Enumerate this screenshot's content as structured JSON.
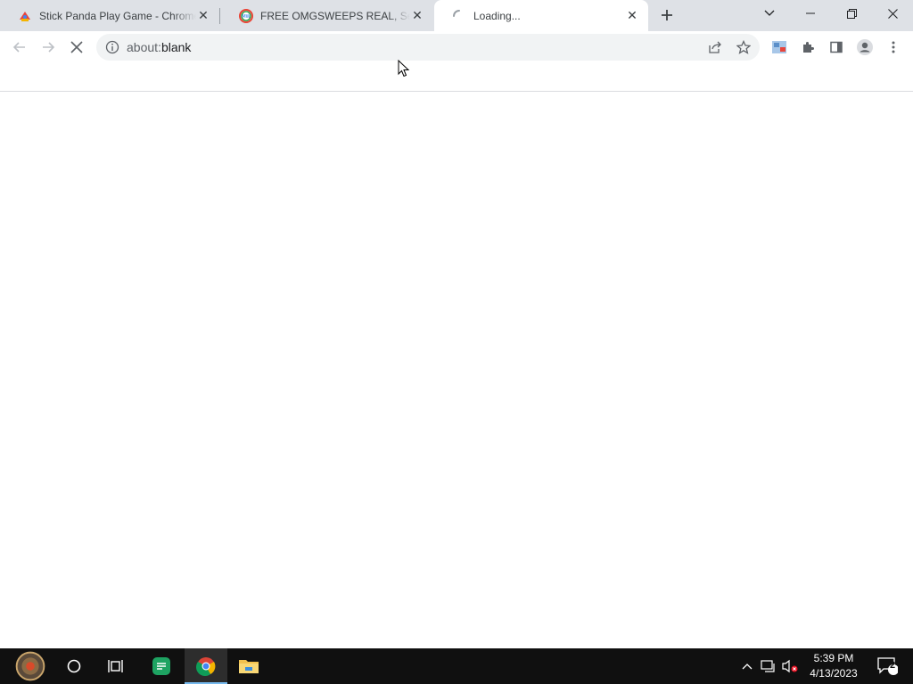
{
  "browser": {
    "tabs": [
      {
        "title": "Stick Panda Play Game - Chrome",
        "favicon": "game-favicon"
      },
      {
        "title": "FREE OMGSWEEPS REAL, Sea",
        "favicon": "mw-favicon"
      },
      {
        "title": "Loading...",
        "favicon": "loading-spinner-icon",
        "active": true
      }
    ],
    "address": {
      "scheme": "about:",
      "rest": "blank"
    }
  },
  "taskbar": {
    "clock_time": "5:39 PM",
    "clock_date": "4/13/2023",
    "notification_count": "2"
  },
  "colors": {
    "tabstrip": "#dee1e6",
    "taskbar": "#101010",
    "accent": "#76b9ed"
  }
}
